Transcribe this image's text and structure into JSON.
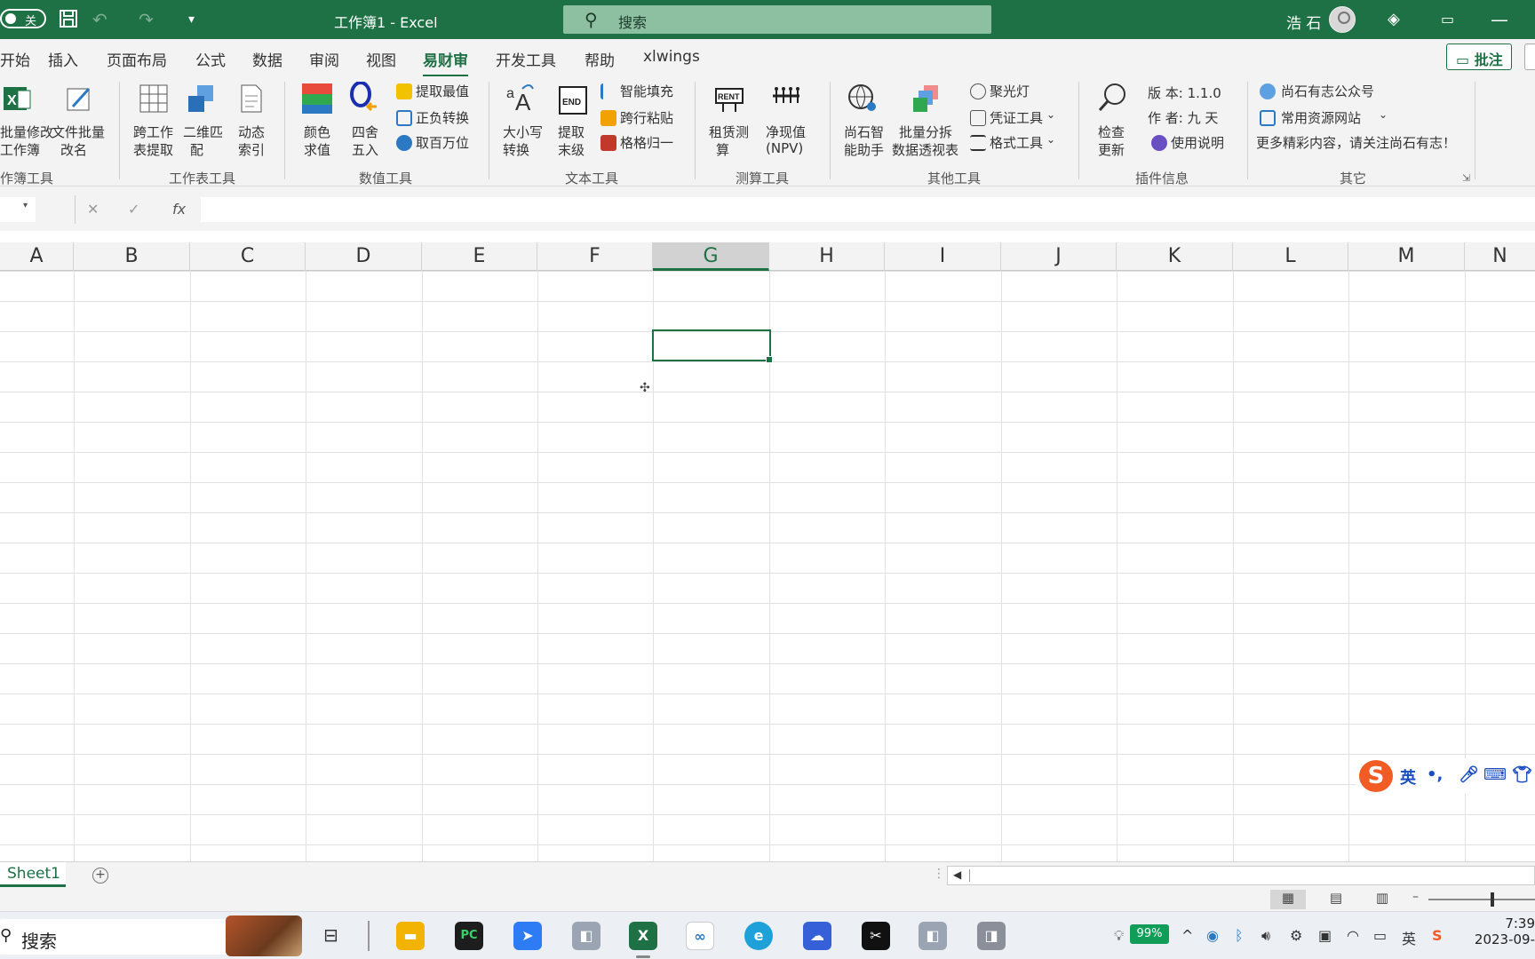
{
  "titlebar": {
    "autosave_state": "关",
    "doc_title": "工作簿1  -  Excel",
    "search_placeholder": "搜索",
    "user_name": "浩 石"
  },
  "menu": {
    "tabs": [
      "开始",
      "插入",
      "页面布局",
      "公式",
      "数据",
      "审阅",
      "视图",
      "易财审",
      "开发工具",
      "帮助",
      "xlwings"
    ],
    "active_tab": "易财审",
    "comment_button": "批注"
  },
  "ribbon": {
    "groups": {
      "workbook_tools": {
        "label": "作簿工具",
        "items": [
          "批量修改",
          "工作簿",
          "文件批量",
          "改名"
        ]
      },
      "sheet_tools": {
        "label": "工作表工具",
        "items": [
          "跨工作",
          "表提取",
          "二维匹",
          "配",
          "动态",
          "索引"
        ]
      },
      "number_tools": {
        "label": "数值工具",
        "items": [
          "颜色",
          "求值",
          "四舍",
          "五入"
        ],
        "small_items": [
          "提取最值",
          "正负转换",
          "取百万位"
        ]
      },
      "text_tools": {
        "label": "文本工具",
        "items": [
          "大小写",
          "转换",
          "提取",
          "末级"
        ],
        "small_items": [
          "智能填充",
          "跨行粘贴",
          "格格归一"
        ]
      },
      "calc_tools": {
        "label": "测算工具",
        "items": [
          "租赁测",
          "算",
          "净现值",
          "(NPV)"
        ]
      },
      "other_tools": {
        "label": "其他工具",
        "items": [
          "尚石智",
          "能助手",
          "批量分拆",
          "数据透视表"
        ],
        "small_items": [
          "聚光灯",
          "凭证工具",
          "格式工具"
        ]
      },
      "plugin_info": {
        "label": "插件信息",
        "items": [
          "检查",
          "更新"
        ],
        "version": "版  本:  1.1.0",
        "author": "作  者:  九  天",
        "manual": "使用说明"
      },
      "misc": {
        "label": "其它",
        "links": [
          "尚石有志公众号",
          "常用资源网站"
        ],
        "promo": "更多精彩内容，请关注尚石有志！"
      }
    }
  },
  "formula_bar": {
    "fx_label": "fx",
    "value": ""
  },
  "grid": {
    "columns": [
      "A",
      "B",
      "C",
      "D",
      "E",
      "F",
      "G",
      "H",
      "I",
      "J",
      "K",
      "L",
      "M",
      "N"
    ],
    "selected_column": "G",
    "active_cell": "G3"
  },
  "ime": {
    "lang": "英",
    "punct": "•,"
  },
  "sheets": {
    "tabs": [
      "Sheet1"
    ],
    "add_label": "+"
  },
  "taskbar": {
    "search_label": "搜索",
    "battery": "99%",
    "time": "7:39",
    "date": "2023-09-"
  }
}
